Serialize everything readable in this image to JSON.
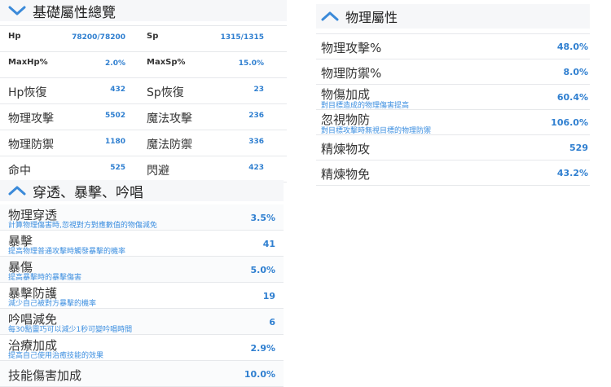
{
  "basic": {
    "title": "基礎屬性總覽",
    "rows": [
      {
        "l_name": "Hp",
        "l_val": "78200/78200",
        "r_name": "Sp",
        "r_val": "1315/1315"
      },
      {
        "l_name": "MaxHp%",
        "l_val": "2.0%",
        "r_name": "MaxSp%",
        "r_val": "15.0%"
      },
      {
        "l_name": "Hp恢復",
        "l_val": "432",
        "r_name": "Sp恢復",
        "r_val": "23"
      },
      {
        "l_name": "物理攻擊",
        "l_val": "5502",
        "r_name": "魔法攻擊",
        "r_val": "236"
      },
      {
        "l_name": "物理防禦",
        "l_val": "1180",
        "r_name": "魔法防禦",
        "r_val": "336"
      },
      {
        "l_name": "命中",
        "l_val": "525",
        "r_name": "閃避",
        "r_val": "423"
      }
    ]
  },
  "penetrate": {
    "title": "穿透、暴擊、吟唱",
    "rows": [
      {
        "name": "物理穿透",
        "desc": "計算物理傷害時,忽視對方對應數值的物傷減免",
        "value": "3.5%"
      },
      {
        "name": "暴擊",
        "desc": "提高物理普通攻擊時觸發暴擊的機率",
        "value": "41"
      },
      {
        "name": "暴傷",
        "desc": "提高暴擊時的暴擊傷害",
        "value": "5.0%"
      },
      {
        "name": "暴擊防護",
        "desc": "減少自己被對方暴擊的機率",
        "value": "19"
      },
      {
        "name": "吟唱減免",
        "desc": "每30點靈巧可以減少1秒可變吟唱時間",
        "value": "6"
      },
      {
        "name": "治療加成",
        "desc": "提高自己使用治癒技能的效果",
        "value": "2.9%"
      },
      {
        "name": "技能傷害加成",
        "desc": "",
        "value": "10.0%"
      }
    ]
  },
  "physical": {
    "title": "物理屬性",
    "rows": [
      {
        "name": "物理攻擊%",
        "desc": "",
        "value": "48.0%"
      },
      {
        "name": "物理防禦%",
        "desc": "",
        "value": "8.0%"
      },
      {
        "name": "物傷加成",
        "desc": "對目標造成的物理傷害提高",
        "value": "60.4%"
      },
      {
        "name": "忽視物防",
        "desc": "對目標攻擊時無視目標的物理防禦",
        "value": "106.0%"
      },
      {
        "name": "精煉物攻",
        "desc": "",
        "value": "529"
      },
      {
        "name": "精煉物免",
        "desc": "",
        "value": "43.2%"
      }
    ]
  },
  "colors": {
    "accent": "#2f7fd0",
    "header_bg": "#f6f7f9"
  }
}
